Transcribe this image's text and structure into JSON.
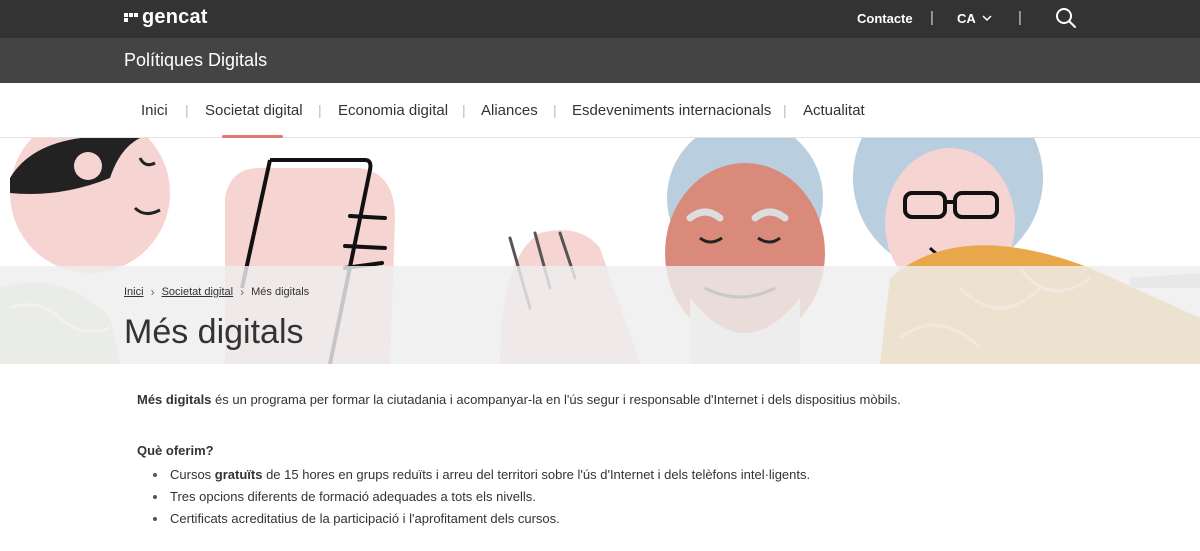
{
  "topbar": {
    "logo_text": "gencat",
    "contact_label": "Contacte",
    "language": "CA",
    "icons": [
      "gencat-logo-icon",
      "chevron-down-icon",
      "search-icon"
    ]
  },
  "site": {
    "title": "Polítiques Digitals"
  },
  "nav": {
    "items": [
      "Inici",
      "Societat digital",
      "Economia digital",
      "Aliances",
      "Esdeveniments internacionals",
      "Actualitat"
    ],
    "active": "Societat digital",
    "separator": "|"
  },
  "breadcrumb": {
    "items": [
      "Inici",
      "Societat digital",
      "Més digitals"
    ]
  },
  "page": {
    "title": "Més digitals",
    "intro_bold": "Més digitals",
    "intro_rest": " és un programa per formar la ciutadania i acompanyar-la en l'ús segur i responsable d'Internet i dels dispositius mòbils.",
    "section_title": "Què oferim?",
    "offers": [
      {
        "before": "Cursos ",
        "bold": "gratuïts",
        "after": " de 15 hores en grups reduïts i arreu del territori sobre l'ús d'Internet i dels telèfons intel·ligents."
      },
      {
        "before": "Tres opcions diferents de formació adequades a tots els nivells.",
        "bold": "",
        "after": ""
      },
      {
        "before": "Certificats acreditatius de la participació i l'aprofitament dels cursos.",
        "bold": "",
        "after": ""
      }
    ]
  },
  "colors": {
    "topbar": "#333333",
    "sitebar": "#444444",
    "active_underline": "#e07a70",
    "hero_pink": "#f2c4c4",
    "hero_skin": "#d98a7a",
    "hero_blue": "#b8cde0",
    "hero_orange": "#e8a84a"
  }
}
